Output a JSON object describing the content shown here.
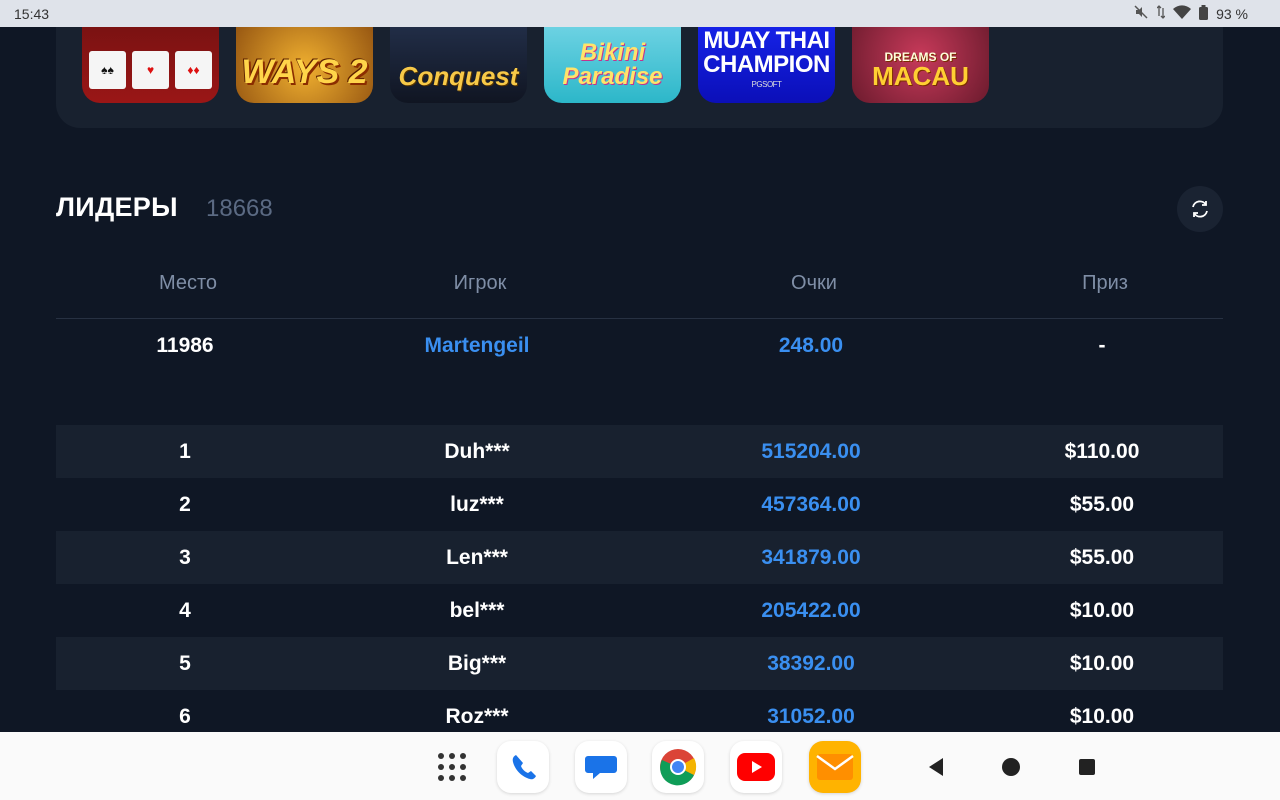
{
  "status": {
    "time": "15:43",
    "battery": "93 %"
  },
  "games": [
    {
      "title": ""
    },
    {
      "title": "WAYS 2"
    },
    {
      "title": "Conquest"
    },
    {
      "title": "Bikini Paradise"
    },
    {
      "title": "MUAY THAI CHAMPION",
      "subtitle": "PGSOFT"
    },
    {
      "title": "MACAU",
      "subtitle": "DREAMS OF"
    }
  ],
  "leaders": {
    "title": "ЛИДЕРЫ",
    "count": "18668",
    "columns": [
      "Место",
      "Игрок",
      "Очки",
      "Приз"
    ],
    "current_user": {
      "place": "11986",
      "player": "Martengeil",
      "points": "248.00",
      "prize": "-"
    },
    "rows": [
      {
        "place": "1",
        "player": "Duh***",
        "points": "515204.00",
        "prize": "$110.00"
      },
      {
        "place": "2",
        "player": "luz***",
        "points": "457364.00",
        "prize": "$55.00"
      },
      {
        "place": "3",
        "player": "Len***",
        "points": "341879.00",
        "prize": "$55.00"
      },
      {
        "place": "4",
        "player": "bel***",
        "points": "205422.00",
        "prize": "$10.00"
      },
      {
        "place": "5",
        "player": "Big***",
        "points": "38392.00",
        "prize": "$10.00"
      },
      {
        "place": "6",
        "player": "Roz***",
        "points": "31052.00",
        "prize": "$10.00"
      }
    ]
  },
  "colors": {
    "background": "#0f1725",
    "panel": "#18212f",
    "accent_blue": "#3a8ff0",
    "muted": "#7f8ea6"
  },
  "navbar": {
    "icons": [
      "app-drawer-icon",
      "phone-icon",
      "messages-icon",
      "chrome-icon",
      "youtube-icon",
      "mail-icon",
      "back-icon",
      "home-icon",
      "recents-icon"
    ]
  }
}
